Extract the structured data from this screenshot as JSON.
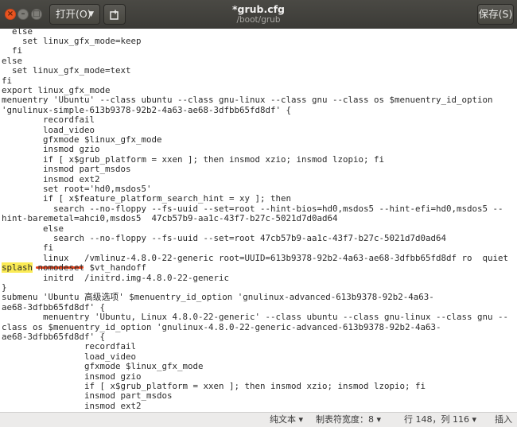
{
  "window": {
    "title": "*grub.cfg",
    "path": "/boot/grub",
    "open_label": "打开(O)",
    "save_label": "保存(S)"
  },
  "editor_lines": [
    "  else",
    "    set linux_gfx_mode=keep",
    "  fi",
    "else",
    "  set linux_gfx_mode=text",
    "fi",
    "export linux_gfx_mode",
    "menuentry 'Ubuntu' --class ubuntu --class gnu-linux --class gnu --class os $menuentry_id_option",
    "'gnulinux-simple-613b9378-92b2-4a63-ae68-3dfbb65fd8df' {",
    "        recordfail",
    "        load_video",
    "        gfxmode $linux_gfx_mode",
    "        insmod gzio",
    "        if [ x$grub_platform = xxen ]; then insmod xzio; insmod lzopio; fi",
    "        insmod part_msdos",
    "        insmod ext2",
    "        set root='hd0,msdos5'",
    "        if [ x$feature_platform_search_hint = xy ]; then",
    "          search --no-floppy --fs-uuid --set=root --hint-bios=hd0,msdos5 --hint-efi=hd0,msdos5 --",
    "hint-baremetal=ahci0,msdos5  47cb57b9-aa1c-43f7-b27c-5021d7d0ad64",
    "        else",
    "          search --no-floppy --fs-uuid --set=root 47cb57b9-aa1c-43f7-b27c-5021d7d0ad64",
    "        fi",
    "        linux   /vmlinuz-4.8.0-22-generic root=UUID=613b9378-92b2-4a63-ae68-3dfbb65fd8df ro  quiet",
    "splash nomodeset $vt_handoff",
    "        initrd  /initrd.img-4.8.0-22-generic",
    "}",
    "submenu 'Ubuntu 高级选项' $menuentry_id_option 'gnulinux-advanced-613b9378-92b2-4a63-",
    "ae68-3dfbb65fd8df' {",
    "        menuentry 'Ubuntu, Linux 4.8.0-22-generic' --class ubuntu --class gnu-linux --class gnu --",
    "class os $menuentry_id_option 'gnulinux-4.8.0-22-generic-advanced-613b9378-92b2-4a63-",
    "ae68-3dfbb65fd8df' {",
    "                recordfail",
    "                load_video",
    "                gfxmode $linux_gfx_mode",
    "                insmod gzio",
    "                if [ x$grub_platform = xxen ]; then insmod xzio; insmod lzopio; fi",
    "                insmod part_msdos",
    "                insmod ext2"
  ],
  "highlight": {
    "word": "splash",
    "rest": " nomodeset $vt_handoff",
    "color": "#fbeb55",
    "underline_color": "#e8421a"
  },
  "status": {
    "language": "纯文本",
    "tab_width": "制表符宽度：8",
    "position": "行 148，列 116",
    "mode": "插入"
  },
  "colors": {
    "accent": "#e95420",
    "titlebar": "#3c3b37"
  }
}
